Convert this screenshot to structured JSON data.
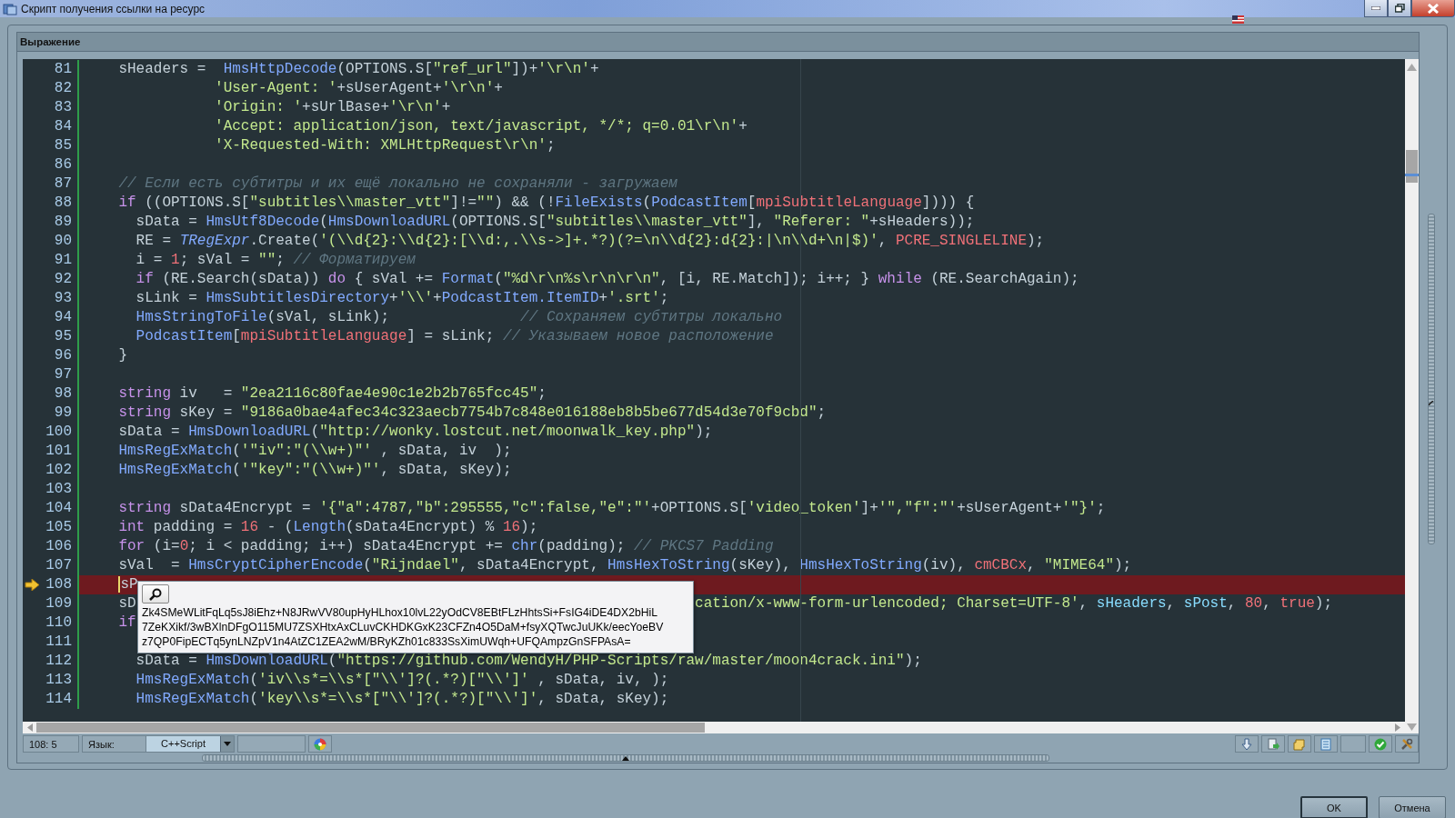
{
  "window": {
    "title": "Скрипт получения ссылки на ресурс"
  },
  "panel": {
    "title": "Выражение"
  },
  "editor": {
    "lines": [
      {
        "number": "81",
        "current": false,
        "tokens": [
          {
            "kind": "plain",
            "text": "    sHeaders =  "
          },
          {
            "kind": "fn",
            "text": "HmsHttpDecode"
          },
          {
            "kind": "plain",
            "text": "(OPTIONS.S["
          },
          {
            "kind": "str",
            "text": "\"ref_url\""
          },
          {
            "kind": "plain",
            "text": "])+"
          },
          {
            "kind": "str",
            "text": "'\\r\\n'"
          },
          {
            "kind": "plain",
            "text": "+"
          }
        ]
      },
      {
        "number": "82",
        "current": false,
        "tokens": [
          {
            "kind": "str",
            "text": "               'User-Agent: '"
          },
          {
            "kind": "plain",
            "text": "+sUserAgent+"
          },
          {
            "kind": "str",
            "text": "'\\r\\n'"
          },
          {
            "kind": "plain",
            "text": "+"
          }
        ]
      },
      {
        "number": "83",
        "current": false,
        "tokens": [
          {
            "kind": "str",
            "text": "               'Origin: '"
          },
          {
            "kind": "plain",
            "text": "+sUrlBase+"
          },
          {
            "kind": "str",
            "text": "'\\r\\n'"
          },
          {
            "kind": "plain",
            "text": "+"
          }
        ]
      },
      {
        "number": "84",
        "current": false,
        "tokens": [
          {
            "kind": "str",
            "text": "               'Accept: application/json, text/javascript, */*; q=0.01\\r\\n'"
          },
          {
            "kind": "plain",
            "text": "+"
          }
        ]
      },
      {
        "number": "85",
        "current": false,
        "tokens": [
          {
            "kind": "str",
            "text": "               'X-Requested-With: XMLHttpRequest\\r\\n'"
          },
          {
            "kind": "plain",
            "text": ";"
          }
        ]
      },
      {
        "number": "86",
        "current": false
      },
      {
        "number": "87",
        "current": false,
        "tokens": [
          {
            "kind": "cmt",
            "text": "    // Если есть субтитры и их ещё локально не сохраняли - загружаем"
          }
        ]
      },
      {
        "number": "88",
        "current": false,
        "tokens": [
          {
            "kind": "kw",
            "text": "    if"
          },
          {
            "kind": "plain",
            "text": " ((OPTIONS.S["
          },
          {
            "kind": "str",
            "text": "\"subtitles\\\\master_vtt\""
          },
          {
            "kind": "plain",
            "text": "]!="
          },
          {
            "kind": "str",
            "text": "\"\""
          },
          {
            "kind": "plain",
            "text": ") && (!"
          },
          {
            "kind": "fn",
            "text": "FileExists"
          },
          {
            "kind": "plain",
            "text": "("
          },
          {
            "kind": "fn",
            "text": "PodcastItem"
          },
          {
            "kind": "plain",
            "text": "["
          },
          {
            "kind": "num",
            "text": "mpiSubtitleLanguage"
          },
          {
            "kind": "plain",
            "text": "]))) {"
          }
        ]
      },
      {
        "number": "89",
        "current": false,
        "tokens": [
          {
            "kind": "plain",
            "text": "      sData = "
          },
          {
            "kind": "fn",
            "text": "HmsUtf8Decode"
          },
          {
            "kind": "plain",
            "text": "("
          },
          {
            "kind": "fn",
            "text": "HmsDownloadURL"
          },
          {
            "kind": "plain",
            "text": "(OPTIONS.S["
          },
          {
            "kind": "str",
            "text": "\"subtitles\\\\master_vtt\""
          },
          {
            "kind": "plain",
            "text": "], "
          },
          {
            "kind": "str",
            "text": "\"Referer: \""
          },
          {
            "kind": "plain",
            "text": "+sHeaders));"
          }
        ]
      },
      {
        "number": "90",
        "current": false,
        "tokens": [
          {
            "kind": "plain",
            "text": "      RE = "
          },
          {
            "kind": "cls",
            "text": "TRegExpr"
          },
          {
            "kind": "plain",
            "text": ".Create("
          },
          {
            "kind": "str",
            "text": "'(\\\\d{2}:\\\\d{2}:[\\\\d:,.\\\\s->]+.*?)(?=\\n\\\\d{2}:d{2}:|\\n\\\\d+\\n|$)'"
          },
          {
            "kind": "plain",
            "text": ", "
          },
          {
            "kind": "num",
            "text": "PCRE_SINGLELINE"
          },
          {
            "kind": "plain",
            "text": ");"
          }
        ]
      },
      {
        "number": "91",
        "current": false,
        "tokens": [
          {
            "kind": "plain",
            "text": "      i = "
          },
          {
            "kind": "num",
            "text": "1"
          },
          {
            "kind": "plain",
            "text": "; sVal = "
          },
          {
            "kind": "str",
            "text": "\"\""
          },
          {
            "kind": "plain",
            "text": "; "
          },
          {
            "kind": "cmt",
            "text": "// Форматируем"
          }
        ]
      },
      {
        "number": "92",
        "current": false,
        "tokens": [
          {
            "kind": "kw",
            "text": "      if"
          },
          {
            "kind": "plain",
            "text": " (RE.Search(sData)) "
          },
          {
            "kind": "kw",
            "text": "do"
          },
          {
            "kind": "plain",
            "text": " { sVal += "
          },
          {
            "kind": "fn",
            "text": "Format"
          },
          {
            "kind": "plain",
            "text": "("
          },
          {
            "kind": "str",
            "text": "\"%d\\r\\n%s\\r\\n\\r\\n\""
          },
          {
            "kind": "plain",
            "text": ", [i, RE.Match]); i++; } "
          },
          {
            "kind": "kw",
            "text": "while"
          },
          {
            "kind": "plain",
            "text": " (RE.SearchAgain);"
          }
        ]
      },
      {
        "number": "93",
        "current": false,
        "tokens": [
          {
            "kind": "plain",
            "text": "      sLink = "
          },
          {
            "kind": "fn",
            "text": "HmsSubtitlesDirectory"
          },
          {
            "kind": "plain",
            "text": "+"
          },
          {
            "kind": "str",
            "text": "'\\\\'"
          },
          {
            "kind": "plain",
            "text": "+"
          },
          {
            "kind": "fn",
            "text": "PodcastItem.ItemID"
          },
          {
            "kind": "plain",
            "text": "+"
          },
          {
            "kind": "str",
            "text": "'.srt'"
          },
          {
            "kind": "plain",
            "text": ";"
          }
        ]
      },
      {
        "number": "94",
        "current": false,
        "tokens": [
          {
            "kind": "fn",
            "text": "      HmsStringToFile"
          },
          {
            "kind": "plain",
            "text": "(sVal, sLink);               "
          },
          {
            "kind": "cmt",
            "text": "// Сохраняем субтитры локально"
          }
        ]
      },
      {
        "number": "95",
        "current": false,
        "tokens": [
          {
            "kind": "fn",
            "text": "      PodcastItem"
          },
          {
            "kind": "plain",
            "text": "["
          },
          {
            "kind": "num",
            "text": "mpiSubtitleLanguage"
          },
          {
            "kind": "plain",
            "text": "] = sLink; "
          },
          {
            "kind": "cmt",
            "text": "// Указываем новое расположение"
          }
        ]
      },
      {
        "number": "96",
        "current": false,
        "tokens": [
          {
            "kind": "plain",
            "text": "    }"
          }
        ]
      },
      {
        "number": "97",
        "current": false
      },
      {
        "number": "98",
        "current": false,
        "tokens": [
          {
            "kind": "kw",
            "text": "    string"
          },
          {
            "kind": "plain",
            "text": " iv   = "
          },
          {
            "kind": "str",
            "text": "\"2ea2116c80fae4e90c1e2b2b765fcc45\""
          },
          {
            "kind": "plain",
            "text": ";"
          }
        ]
      },
      {
        "number": "99",
        "current": false,
        "tokens": [
          {
            "kind": "kw",
            "text": "    string"
          },
          {
            "kind": "plain",
            "text": " sKey = "
          },
          {
            "kind": "str",
            "text": "\"9186a0bae4afec34c323aecb7754b7c848e016188eb8b5be677d54d3e70f9cbd\""
          },
          {
            "kind": "plain",
            "text": ";"
          }
        ]
      },
      {
        "number": "100",
        "current": false,
        "tokens": [
          {
            "kind": "plain",
            "text": "    sData = "
          },
          {
            "kind": "fn",
            "text": "HmsDownloadURL"
          },
          {
            "kind": "plain",
            "text": "("
          },
          {
            "kind": "str",
            "text": "\"http://wonky.lostcut.net/moonwalk_key.php\""
          },
          {
            "kind": "plain",
            "text": ");"
          }
        ]
      },
      {
        "number": "101",
        "current": false,
        "tokens": [
          {
            "kind": "fn",
            "text": "    HmsRegExMatch"
          },
          {
            "kind": "plain",
            "text": "("
          },
          {
            "kind": "str",
            "text": "'\"iv\":\"(\\\\w+)\"'"
          },
          {
            "kind": "plain",
            "text": " , sData, iv  );"
          }
        ]
      },
      {
        "number": "102",
        "current": false,
        "tokens": [
          {
            "kind": "fn",
            "text": "    HmsRegExMatch"
          },
          {
            "kind": "plain",
            "text": "("
          },
          {
            "kind": "str",
            "text": "'\"key\":\"(\\\\w+)\"'"
          },
          {
            "kind": "plain",
            "text": ", sData, sKey);"
          }
        ]
      },
      {
        "number": "103",
        "current": false
      },
      {
        "number": "104",
        "current": false,
        "tokens": [
          {
            "kind": "kw",
            "text": "    string"
          },
          {
            "kind": "plain",
            "text": " sData4Encrypt = "
          },
          {
            "kind": "str",
            "text": "'{\"a\":4787,\"b\":295555,\"c\":false,\"e\":\"'"
          },
          {
            "kind": "plain",
            "text": "+OPTIONS.S["
          },
          {
            "kind": "str",
            "text": "'video_token'"
          },
          {
            "kind": "plain",
            "text": "]+"
          },
          {
            "kind": "str",
            "text": "'\",\"f\":\"'"
          },
          {
            "kind": "plain",
            "text": "+sUserAgent+"
          },
          {
            "kind": "str",
            "text": "'\"}'"
          },
          {
            "kind": "plain",
            "text": ";"
          }
        ]
      },
      {
        "number": "105",
        "current": false,
        "tokens": [
          {
            "kind": "kw",
            "text": "    int"
          },
          {
            "kind": "plain",
            "text": " padding = "
          },
          {
            "kind": "num",
            "text": "16"
          },
          {
            "kind": "plain",
            "text": " - ("
          },
          {
            "kind": "fn",
            "text": "Length"
          },
          {
            "kind": "plain",
            "text": "(sData4Encrypt) % "
          },
          {
            "kind": "num",
            "text": "16"
          },
          {
            "kind": "plain",
            "text": ");"
          }
        ]
      },
      {
        "number": "106",
        "current": false,
        "tokens": [
          {
            "kind": "kw",
            "text": "    for"
          },
          {
            "kind": "plain",
            "text": " (i="
          },
          {
            "kind": "num",
            "text": "0"
          },
          {
            "kind": "plain",
            "text": "; i < padding; i++) sData4Encrypt += "
          },
          {
            "kind": "fn",
            "text": "chr"
          },
          {
            "kind": "plain",
            "text": "(padding); "
          },
          {
            "kind": "cmt",
            "text": "// PKCS7 Padding"
          }
        ]
      },
      {
        "number": "107",
        "current": false,
        "tokens": [
          {
            "kind": "plain",
            "text": "    sVal  = "
          },
          {
            "kind": "fn",
            "text": "HmsCryptCipherEncode"
          },
          {
            "kind": "plain",
            "text": "("
          },
          {
            "kind": "str",
            "text": "\"Rijndael\""
          },
          {
            "kind": "plain",
            "text": ", sData4Encrypt, "
          },
          {
            "kind": "fn",
            "text": "HmsHexToString"
          },
          {
            "kind": "plain",
            "text": "(sKey), "
          },
          {
            "kind": "fn",
            "text": "HmsHexToString"
          },
          {
            "kind": "plain",
            "text": "(iv), "
          },
          {
            "kind": "num",
            "text": "cmCBCx"
          },
          {
            "kind": "plain",
            "text": ", "
          },
          {
            "kind": "str",
            "text": "\"MIME64\""
          },
          {
            "kind": "plain",
            "text": ");"
          }
        ]
      },
      {
        "number": "108",
        "current": true,
        "tokens": [
          {
            "kind": "plain",
            "text": "    sP"
          }
        ]
      },
      {
        "number": "109",
        "current": false,
        "tokens": [
          {
            "kind": "plain",
            "text": "    sD"
          },
          {
            "kind": "str",
            "text": "                                                                cation/x-www-form-urlencoded; Charset=UTF-8'"
          },
          {
            "kind": "plain",
            "text": ", "
          },
          {
            "kind": "var",
            "text": "sHeaders"
          },
          {
            "kind": "plain",
            "text": ", "
          },
          {
            "kind": "var",
            "text": "sPost"
          },
          {
            "kind": "plain",
            "text": ", "
          },
          {
            "kind": "num",
            "text": "80"
          },
          {
            "kind": "plain",
            "text": ", "
          },
          {
            "kind": "num",
            "text": "true"
          },
          {
            "kind": "plain",
            "text": ");"
          }
        ]
      },
      {
        "number": "110",
        "current": false,
        "tokens": [
          {
            "kind": "kw",
            "text": "    if"
          }
        ]
      },
      {
        "number": "111",
        "current": false
      },
      {
        "number": "112",
        "current": false,
        "tokens": [
          {
            "kind": "plain",
            "text": "      sData = "
          },
          {
            "kind": "fn",
            "text": "HmsDownloadURL"
          },
          {
            "kind": "plain",
            "text": "("
          },
          {
            "kind": "str",
            "text": "\"https://github.com/WendyH/PHP-Scripts/raw/master/moon4crack.ini\""
          },
          {
            "kind": "plain",
            "text": ");"
          }
        ]
      },
      {
        "number": "113",
        "current": false,
        "tokens": [
          {
            "kind": "fn",
            "text": "      HmsRegExMatch"
          },
          {
            "kind": "plain",
            "text": "("
          },
          {
            "kind": "str",
            "text": "'iv\\\\s*=\\\\s*[\"\\\\']?(.*?)[\"\\\\']'"
          },
          {
            "kind": "plain",
            "text": " , sData, iv, );"
          }
        ]
      },
      {
        "number": "114",
        "current": false,
        "tokens": [
          {
            "kind": "fn",
            "text": "      HmsRegExMatch"
          },
          {
            "kind": "plain",
            "text": "("
          },
          {
            "kind": "str",
            "text": "'key\\\\s*=\\\\s*[\"\\\\']?(.*?)[\"\\\\']'"
          },
          {
            "kind": "plain",
            "text": ", sData, sKey);"
          }
        ]
      }
    ],
    "tooltip": {
      "lines": [
        "Zk4SMeWLitFqLq5sJ8iEhz+N8JRwVV80upHyHLhox10lvL22yOdCV8EBtFLzHhtsSi+FsIG4iDE4DX2bHiL",
        "7ZeKXikf/3wBXlnDFgO115MU7ZSXHtxAxCLuvCKHDKGxK23CFZn4O5DaM+fsyXQTwcJuUKk/eecYoeBV",
        "z7QP0FipECTq5ynLNZpV1n4AtZC1ZEA2wM/BRyKZh01c833SsXimUWqh+UFQAmpzGnSFPAsA="
      ]
    }
  },
  "status_bar": {
    "position": "108:  5",
    "language_label": "Язык:",
    "language": "C++Script"
  },
  "buttons": {
    "ok": "OK",
    "cancel": "Отмена"
  }
}
